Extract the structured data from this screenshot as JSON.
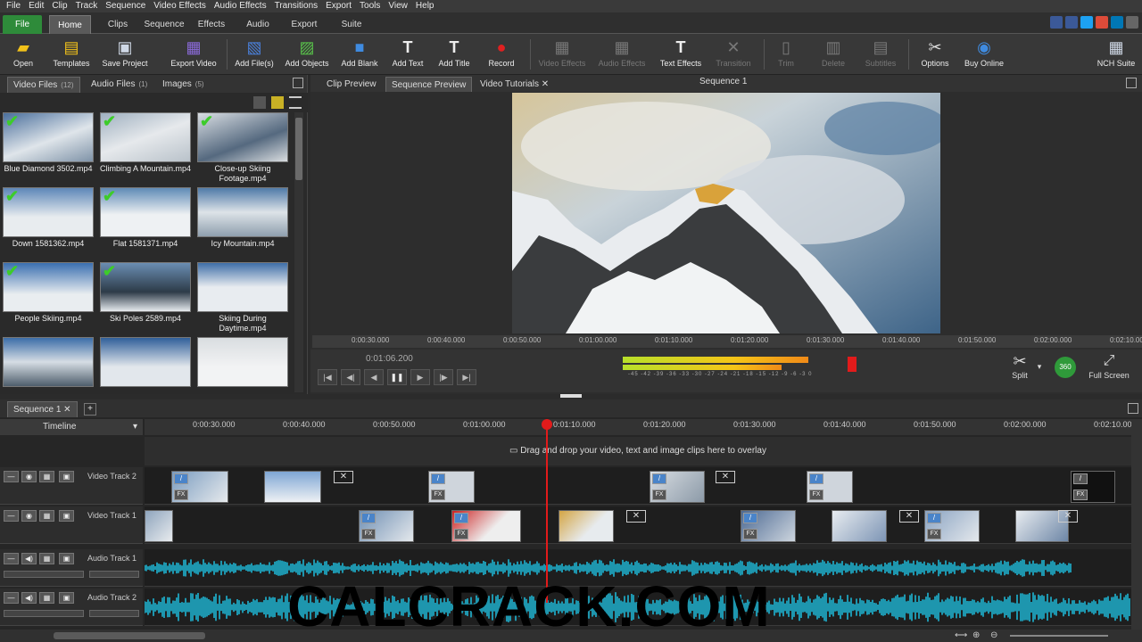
{
  "menu": [
    "File",
    "Edit",
    "Clip",
    "Track",
    "Sequence",
    "Video Effects",
    "Audio Effects",
    "Transitions",
    "Export",
    "Tools",
    "View",
    "Help"
  ],
  "tabs": {
    "file": "File",
    "home": "Home",
    "clips": "Clips",
    "sequence": "Sequence",
    "effects": "Effects",
    "audio": "Audio",
    "export": "Export",
    "suite": "Suite"
  },
  "ribbon": {
    "open": "Open",
    "templates": "Templates",
    "save_project": "Save Project",
    "export_video": "Export Video",
    "add_files": "Add File(s)",
    "add_objects": "Add Objects",
    "add_blank": "Add Blank",
    "add_text": "Add Text",
    "add_title": "Add Title",
    "record": "Record",
    "video_effects": "Video Effects",
    "audio_effects": "Audio Effects",
    "text_effects": "Text Effects",
    "transition": "Transition",
    "trim": "Trim",
    "delete": "Delete",
    "subtitles": "Subtitles",
    "options": "Options",
    "buy_online": "Buy Online",
    "nch_suite": "NCH Suite"
  },
  "media_tabs": {
    "video": "Video Files",
    "video_count": "(12)",
    "audio": "Audio Files",
    "audio_count": "(1)",
    "images": "Images",
    "images_count": "(5)"
  },
  "media": [
    {
      "name": "Blue Diamond 3502.mp4",
      "checked": true
    },
    {
      "name": "Climbing A Mountain.mp4",
      "checked": true
    },
    {
      "name": "Close-up Skiing Footage.mp4",
      "checked": true
    },
    {
      "name": "Down 1581362.mp4",
      "checked": true
    },
    {
      "name": "Flat 1581371.mp4",
      "checked": true
    },
    {
      "name": "Icy Mountain.mp4",
      "checked": false
    },
    {
      "name": "People Skiing.mp4",
      "checked": true
    },
    {
      "name": "Ski Poles 2589.mp4",
      "checked": true
    },
    {
      "name": "Skiing During Daytime.mp4",
      "checked": false
    },
    {
      "name": "",
      "checked": false
    },
    {
      "name": "",
      "checked": false
    },
    {
      "name": "",
      "checked": false
    }
  ],
  "preview_tabs": {
    "clip": "Clip Preview",
    "sequence": "Sequence Preview",
    "tutorials": "Video Tutorials"
  },
  "preview_title": "Sequence 1",
  "preview_ruler": [
    "0:00:30.000",
    "0:00:40.000",
    "0:00:50.000",
    "0:01:00.000",
    "0:01:10.000",
    "0:01:20.000",
    "0:01:30.000",
    "0:01:40.000",
    "0:01:50.000",
    "0:02:00.000",
    "0:02:10.000"
  ],
  "timecode": "0:01:06.200",
  "meter_scale": "-45 -42 -39 -36 -33 -30 -27 -24 -21 -18 -15 -12 -9 -6 -3 0",
  "controls": {
    "split": "Split",
    "fullscreen": "Full Screen",
    "vr": "360"
  },
  "sequence_tab": "Sequence 1",
  "timeline_label": "Timeline",
  "timeline_ruler": [
    "0:00:30.000",
    "0:00:40.000",
    "0:00:50.000",
    "0:01:00.000",
    "0:01:10.000",
    "0:01:20.000",
    "0:01:30.000",
    "0:01:40.000",
    "0:01:50.000",
    "0:02:00.000",
    "0:02:10.000"
  ],
  "overlay_hint": "Drag and drop your video, text and image clips here to overlay",
  "tracks": {
    "v2": "Video Track 2",
    "v1": "Video Track 1",
    "a1": "Audio Track 1",
    "a2": "Audio Track 2"
  },
  "watermark": "CALCRACK.COM",
  "colors": {
    "accent_green": "#2e8b3a",
    "playhead": "#e21b1b",
    "waveform": "#1eb4d2"
  }
}
